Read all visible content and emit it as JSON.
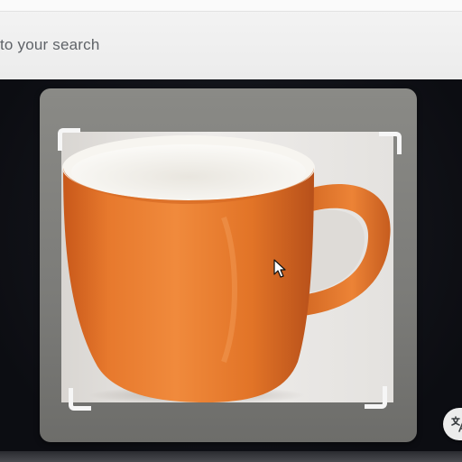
{
  "search": {
    "partial_text": "to your search"
  },
  "lens": {
    "selection_image": "orange-mug-photo",
    "cursor": "arrow-cursor-icon"
  },
  "buttons": {
    "translate_icon": "translate-icon"
  },
  "colors": {
    "mug_orange": "#e8782a",
    "mug_interior": "#f3f1ec",
    "panel_grey": "#7e7e7b",
    "dark_background": "#101218"
  }
}
